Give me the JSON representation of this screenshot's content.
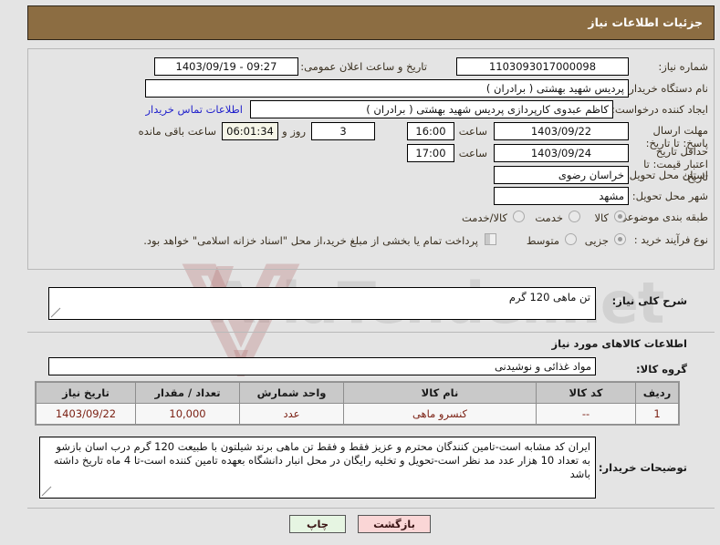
{
  "header": {
    "title": "جزئیات اطلاعات نیاز",
    "bg_color": "#8c6d42"
  },
  "details": {
    "need_number_label": "شماره نیاز:",
    "need_number_value": "1103093017000098",
    "announce_label": "تاریخ و ساعت اعلان عمومی:",
    "announce_value": "09:27 - 1403/09/19",
    "buyer_org_label": "نام دستگاه خریدار:",
    "buyer_org_value": "پردیس شهید بهشتی ( برادران )",
    "creator_label": "ایجاد کننده درخواست:",
    "creator_value": "کاظم  عبدوی  کارپردازی  پردیس شهید بهشتی ( برادران )",
    "contact_link": "اطلاعات تماس خریدار",
    "deadline_label": "مهلت ارسال پاسخ: تا تاریخ:",
    "deadline_date": "1403/09/22",
    "hour_label": "ساعت",
    "deadline_time": "16:00",
    "days_remaining": "3",
    "days_word": "روز و",
    "time_remaining": "06:01:34",
    "remaining_label": "ساعت باقی مانده",
    "price_validity_label": "حداقل تاریخ اعتبار قیمت: تا تاریخ:",
    "price_validity_date": "1403/09/24",
    "price_validity_time": "17:00",
    "province_label": "استان محل تحویل:",
    "province_value": "خراسان رضوی",
    "city_label": "شهر محل تحویل:",
    "city_value": "مشهد",
    "category_label": "طبقه بندی موضوعی:",
    "category_options": [
      "کالا",
      "خدمت",
      "کالا/خدمت"
    ],
    "category_selected": "کالا",
    "process_label": "نوع فرآیند خرید :",
    "process_options": [
      "جزیی",
      "متوسط"
    ],
    "process_selected": "جزیی",
    "treasury_checkbox_text": "پرداخت تمام یا بخشی از مبلغ خرید،از محل \"اسناد خزانه اسلامی\" خواهد بود.",
    "treasury_checked": false
  },
  "description": {
    "label": "شرح کلی نیاز:",
    "value": "تن ماهی 120 گرم"
  },
  "goods_info": {
    "section_title": "اطلاعات کالاهای مورد نیاز",
    "group_label": "گروه کالا:",
    "group_value": "مواد غذائی و نوشیدنی"
  },
  "table": {
    "columns": [
      "ردیف",
      "کد کالا",
      "نام کالا",
      "واحد شمارش",
      "تعداد / مقدار",
      "تاریخ نیاز"
    ],
    "rows": [
      [
        "1",
        "--",
        "کنسرو ماهی",
        "عدد",
        "10,000",
        "1403/09/22"
      ]
    ]
  },
  "buyer_notes": {
    "label": "توضیحات خریدار:",
    "value": "ایران کد مشابه است-تامین کنندگان محترم و عزیز فقط و فقط تن ماهی برند شیلتون با طبیعت 120 گرم درب اسان بازشو به تعداد 10 هزار عدد مد نظر است-تحویل و تخلیه رایگان در محل انبار دانشگاه بعهده تامین کننده است-تا 4 ماه تاریخ داشته باشد"
  },
  "buttons": {
    "print": "چاپ",
    "back": "بازگشت"
  },
  "watermark": {
    "text": "AriaTender.net"
  }
}
